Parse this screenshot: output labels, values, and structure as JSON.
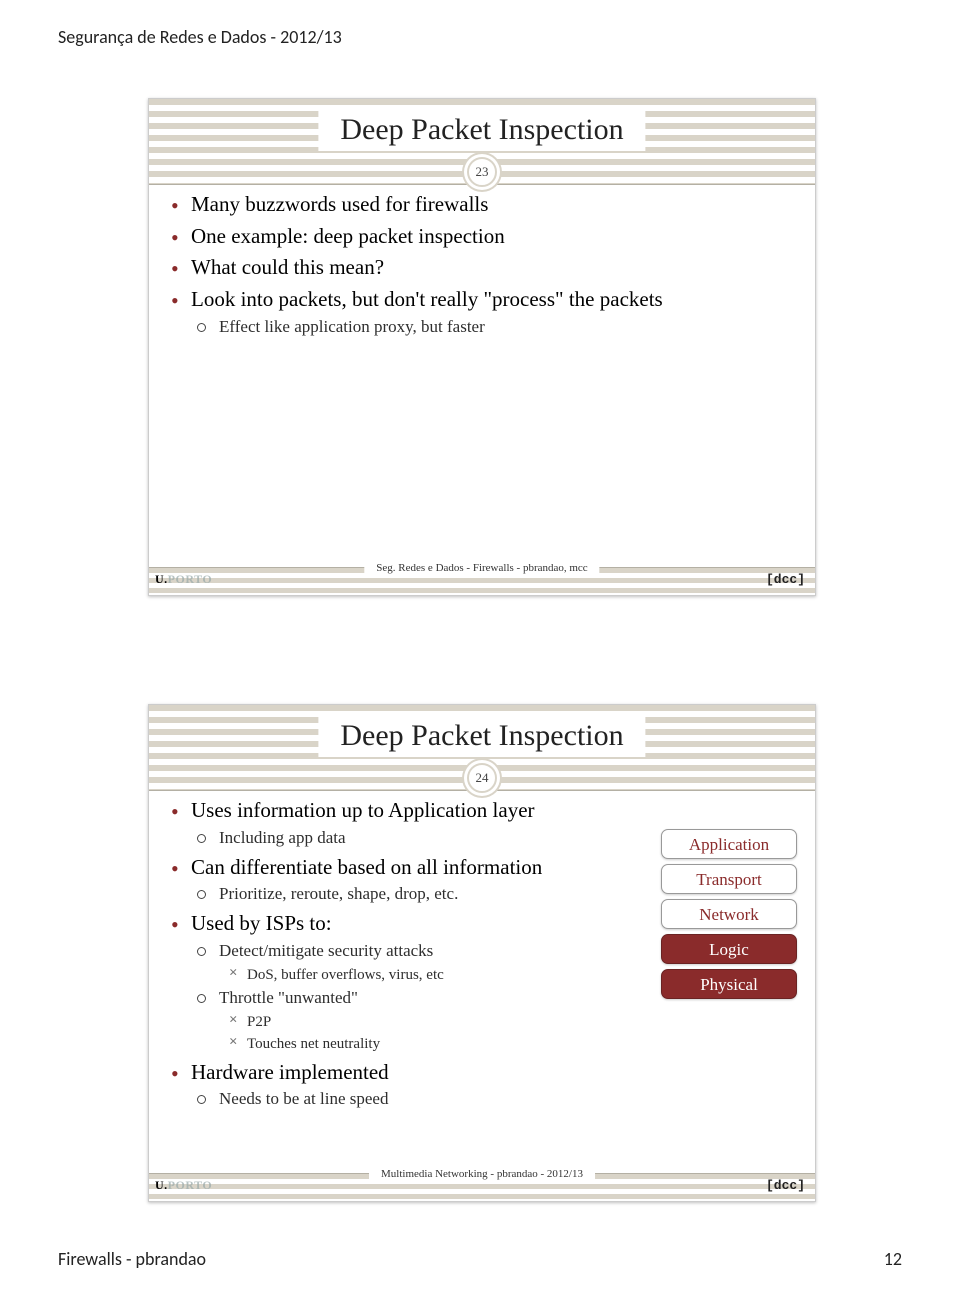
{
  "header": "Segurança de Redes e Dados - 2012/13",
  "footer_left": "Firewalls - pbrandao",
  "footer_right": "12",
  "slide1": {
    "title": "Deep Packet Inspection",
    "num": "23",
    "b1": "Many buzzwords used for firewalls",
    "b2": "One example: deep packet inspection",
    "b3": "What could this mean?",
    "b4": "Look into packets, but don't really \"process\" the packets",
    "b4_sub1": "Effect like application proxy, but faster",
    "footer": "Seg. Redes e Dados - Firewalls - pbrandao, mcc"
  },
  "slide2": {
    "title": "Deep Packet Inspection",
    "num": "24",
    "b1": "Uses information up to Application layer",
    "b1_sub1": "Including app data",
    "b2": "Can differentiate based on all information",
    "b2_sub1": "Prioritize, reroute, shape, drop, etc.",
    "b3": "Used by ISPs to:",
    "b3_sub1": "Detect/mitigate security attacks",
    "b3_sub1_a": "DoS, buffer overflows, virus, etc",
    "b3_sub2": "Throttle \"unwanted\"",
    "b3_sub2_a": "P2P",
    "b3_sub2_b": "Touches net neutrality",
    "b4": "Hardware implemented",
    "b4_sub1": "Needs to be at line speed",
    "footer": "Multimedia Networking - pbrandao - 2012/13"
  },
  "layers": {
    "l1": "Application",
    "l2": "Transport",
    "l3": "Network",
    "l4": "Logic",
    "l5": "Physical"
  },
  "logos": {
    "uporto_u": "U.",
    "uporto_text": "PORTO",
    "dcc": "[dcc]"
  }
}
